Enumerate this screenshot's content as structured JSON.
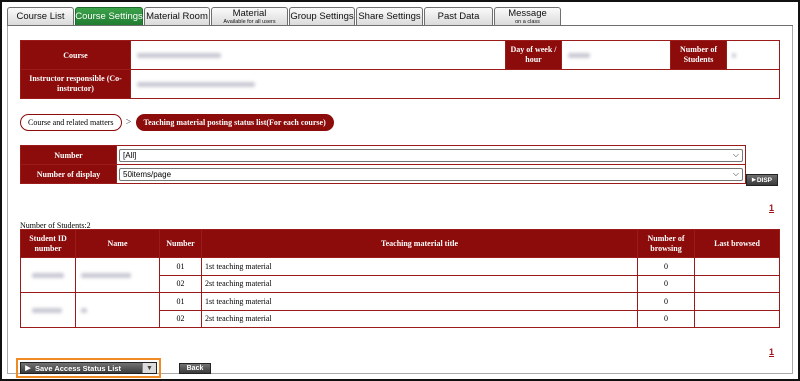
{
  "tabs": [
    {
      "label": "Course List",
      "sub": "",
      "active": false
    },
    {
      "label": "Course Settings",
      "sub": "",
      "active": true
    },
    {
      "label": "Material Room",
      "sub": "",
      "active": false
    },
    {
      "label": "Material",
      "sub": "Available for all users",
      "active": false
    },
    {
      "label": "Group Settings",
      "sub": "",
      "active": false
    },
    {
      "label": "Share Settings",
      "sub": "",
      "active": false
    },
    {
      "label": "Past Data",
      "sub": "",
      "active": false
    },
    {
      "label": "Message",
      "sub": "on a class",
      "active": false
    }
  ],
  "course_info": {
    "course_label": "Course",
    "day_label": "Day of week / hour",
    "students_label": "Number of Students",
    "instructor_label": "Instructor responsible (Co-instructor)"
  },
  "breadcrumb": {
    "parent": "Course and related matters",
    "separator": ">",
    "current": "Teaching material posting status list(For each course)"
  },
  "filter": {
    "number_label": "Number",
    "number_value": "[All]",
    "display_label": "Number of display",
    "display_value": "50items/page",
    "disp_button": "DISP"
  },
  "pager": {
    "top": "1",
    "bottom": "1"
  },
  "student_count": "Number of Students:2",
  "table": {
    "headers": [
      "Student ID number",
      "Name",
      "Number",
      "Teaching material title",
      "Number of browsing",
      "Last browsed"
    ],
    "rows": [
      {
        "number": "01",
        "title": "1st teaching material",
        "browsing": "0",
        "last": ""
      },
      {
        "number": "02",
        "title": "2st teaching material",
        "browsing": "0",
        "last": ""
      },
      {
        "number": "01",
        "title": "1st teaching material",
        "browsing": "0",
        "last": ""
      },
      {
        "number": "02",
        "title": "2st teaching material",
        "browsing": "0",
        "last": ""
      }
    ]
  },
  "buttons": {
    "save": "Save Access Status List",
    "back": "Back"
  },
  "colors": {
    "header": "#8c0b0b",
    "active_tab": "#2a8a3a",
    "highlight": "#f08a24",
    "pager": "#a3151d"
  },
  "icons": {
    "save": "play-icon",
    "dropdown": "chevron-down-icon",
    "breadcrumb": "chevron-right-icon"
  }
}
